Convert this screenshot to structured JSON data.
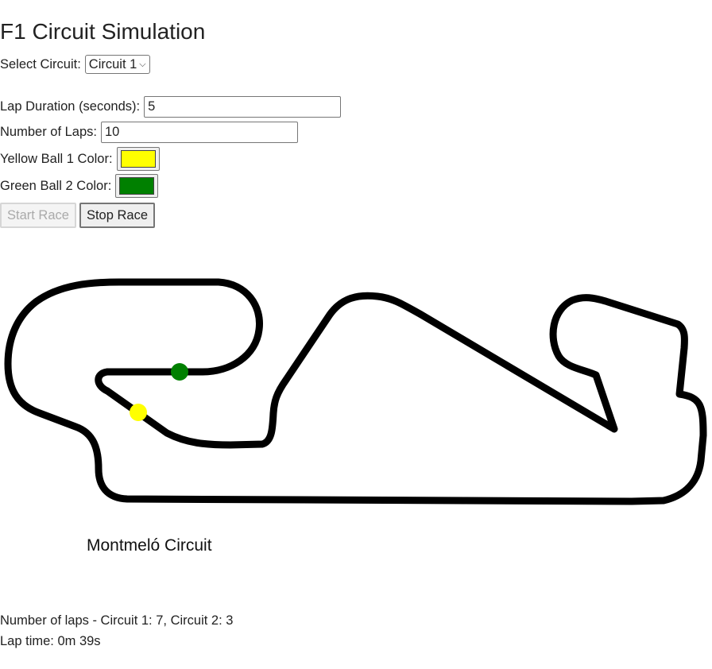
{
  "page": {
    "title": "F1 Circuit Simulation"
  },
  "controls": {
    "circuit_label": "Select Circuit:",
    "circuit_value": "Circuit 1",
    "lap_duration_label": "Lap Duration (seconds):",
    "lap_duration_value": "5",
    "laps_label": "Number of Laps:",
    "laps_value": "10",
    "ball1_label": "Yellow Ball 1 Color:",
    "ball1_color": "#ffff00",
    "ball2_label": "Green Ball 2 Color:",
    "ball2_color": "#008000",
    "start_label": "Start Race",
    "stop_label": "Stop Race"
  },
  "circuit": {
    "name": "Montmeló Circuit"
  },
  "stats": {
    "laps_text": "Number of laps - Circuit 1: 7, Circuit 2: 3",
    "lap_time_text": "Lap time: 0m 39s"
  }
}
